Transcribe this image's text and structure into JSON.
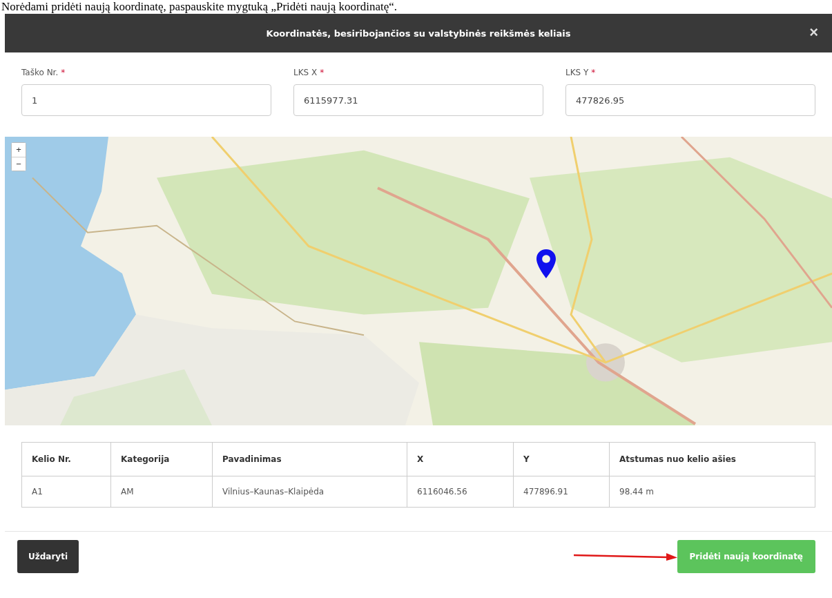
{
  "note": "Norėdami pridėti naują koordinatę, paspauskite mygtuką „Pridėti naują koordinatę“.",
  "modal": {
    "title": "Koordinatės, besiribojančios su valstybinės reikšmės keliais",
    "close": "×"
  },
  "fields": [
    {
      "label": "Taško Nr.",
      "required_mark": "*",
      "value": "1"
    },
    {
      "label": "LKS X",
      "required_mark": "*",
      "value": "6115977.31"
    },
    {
      "label": "LKS Y",
      "required_mark": "*",
      "value": "477826.95"
    }
  ],
  "map": {
    "kind": "picture",
    "zoom_in": "+",
    "zoom_out": "−"
  },
  "table": {
    "columns": [
      "Kelio Nr.",
      "Kategorija",
      "Pavadinimas",
      "X",
      "Y",
      "Atstumas nuo kelio ašies"
    ],
    "rows": [
      [
        "A1",
        "AM",
        "Vilnius–Kaunas–Klaipėda",
        "6116046.56",
        "477896.91",
        "98.44 m"
      ]
    ]
  },
  "buttons": [
    {
      "label": "Uždaryti",
      "kind": "dark"
    },
    {
      "label": "Pridėti naują koordinatę",
      "kind": "success"
    }
  ]
}
